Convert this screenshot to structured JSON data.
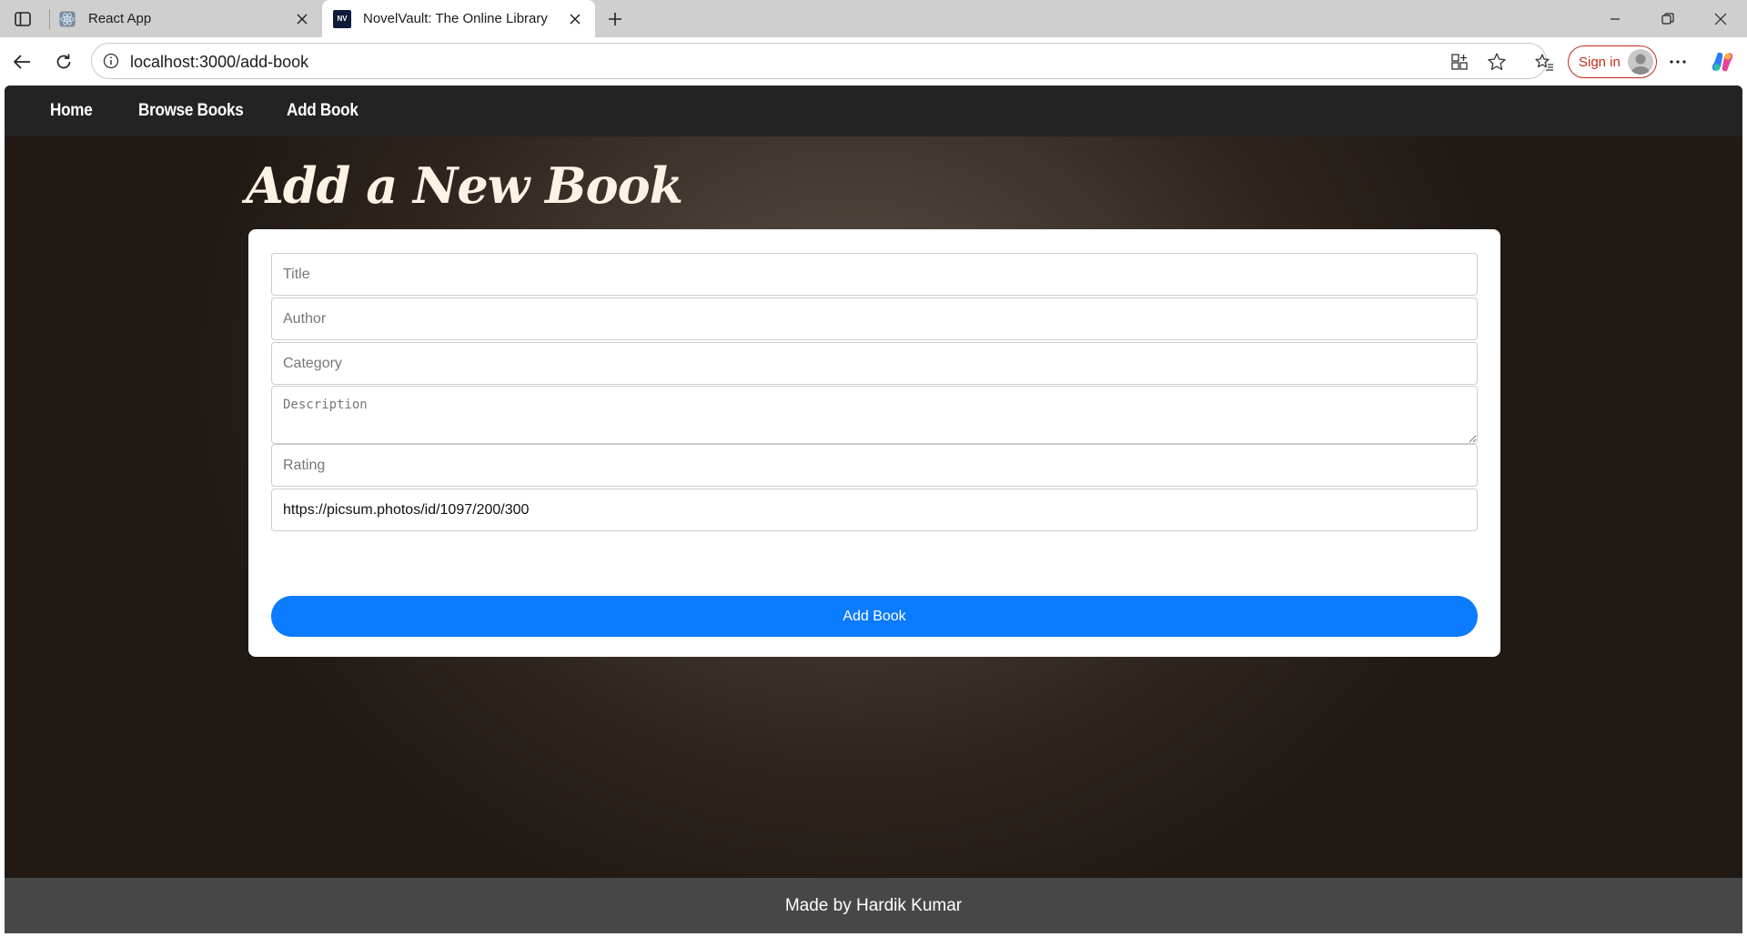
{
  "browser": {
    "tabs": [
      {
        "label": "React App",
        "favicon": "react-icon",
        "active": false
      },
      {
        "label": "NovelVault: The Online Library",
        "favicon": "nv-logo-icon",
        "favicon_text": "NV",
        "active": true
      }
    ],
    "address": {
      "url": "localhost:3000/add-book"
    },
    "signin_label": "Sign in"
  },
  "navbar": {
    "links": [
      {
        "label": "Home"
      },
      {
        "label": "Browse Books"
      },
      {
        "label": "Add Book"
      }
    ]
  },
  "page": {
    "heading": "Add a New Book"
  },
  "form": {
    "title": {
      "placeholder": "Title",
      "value": ""
    },
    "author": {
      "placeholder": "Author",
      "value": ""
    },
    "category": {
      "placeholder": "Category",
      "value": ""
    },
    "description": {
      "placeholder": "Description",
      "value": ""
    },
    "rating": {
      "placeholder": "Rating",
      "value": ""
    },
    "image_url": {
      "placeholder": "",
      "value": "https://picsum.photos/id/1097/200/300"
    },
    "submit_label": "Add Book"
  },
  "footer": {
    "text": "Made by Hardik Kumar"
  },
  "colors": {
    "accent": "#0b7bff",
    "navbar": "#232323",
    "footer": "#474747",
    "heading": "#fbf3e4",
    "signin": "#c42b1c"
  }
}
